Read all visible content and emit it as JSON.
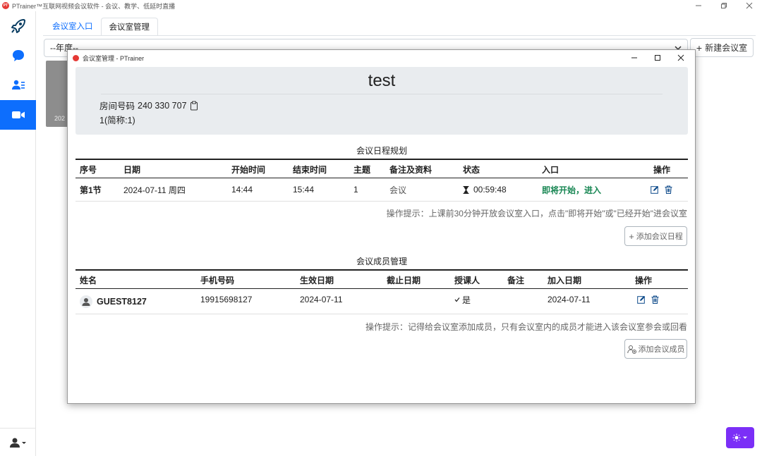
{
  "app": {
    "title": "PTrainer™互联网视频会议软件 - 会议、教学、低延时直播",
    "logo_text": "PT"
  },
  "sidebar": {
    "items": [
      {
        "icon": "rocket-icon",
        "active": false
      },
      {
        "icon": "chat-icon",
        "active": false
      },
      {
        "icon": "contacts-icon",
        "active": false
      },
      {
        "icon": "video-camera-icon",
        "active": true
      }
    ],
    "bottom_icon": "user-menu-icon"
  },
  "tabs": [
    {
      "label": "会议室入口",
      "active": false
    },
    {
      "label": "会议室管理",
      "active": true
    }
  ],
  "year_select": {
    "value": "--年度--"
  },
  "new_room_button": {
    "label": "新建会议室"
  },
  "room_card": {
    "year_text": "202"
  },
  "dialog": {
    "title": "会议室管理 - PTrainer",
    "room": {
      "name": "test",
      "number_label": "房间号码",
      "number": "240 330 707",
      "alias": "1(简称:1)"
    },
    "schedule": {
      "title": "会议日程规划",
      "columns": [
        "序号",
        "日期",
        "开始时间",
        "结束时间",
        "主题",
        "备注及资料",
        "状态",
        "入口",
        "操作"
      ],
      "rows": [
        {
          "index": "第1节",
          "date": "2024-07-11 周四",
          "start": "14:44",
          "end": "15:44",
          "topic": "1",
          "note": "会议",
          "status": "00:59:48",
          "entry": "即将开始，进入"
        }
      ],
      "hint": "操作提示：上课前30分钟开放会议室入口，点击\"即将开始\"或\"已经开始\"进会议室",
      "add_button": "添加会议日程"
    },
    "members": {
      "title": "会议成员管理",
      "columns": [
        "姓名",
        "手机号码",
        "生效日期",
        "截止日期",
        "授课人",
        "备注",
        "加入日期",
        "操作"
      ],
      "rows": [
        {
          "name": "GUEST8127",
          "phone": "19915698127",
          "effective": "2024-07-11",
          "expire": "",
          "teacher": "是",
          "note": "",
          "joined": "2024-07-11"
        }
      ],
      "hint": "操作提示：记得给会议室添加成员，只有会议室内的成员才能进入该会议室参会或回看",
      "add_button": "添加会议成员"
    }
  },
  "colors": {
    "accent": "#0d6efd",
    "theme_button": "#7b2ff7",
    "entry_green": "#198754",
    "brand_red": "#e53935"
  }
}
